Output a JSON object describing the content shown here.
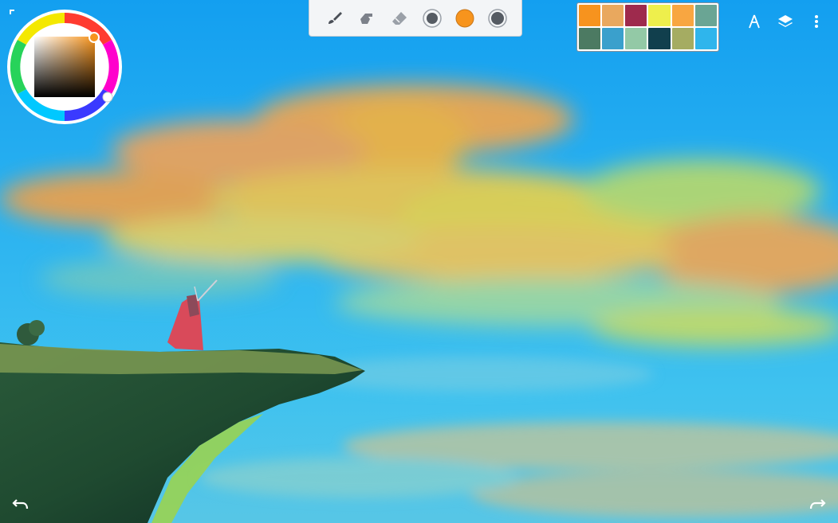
{
  "canvas": {
    "painting": "sky-cliff-painting"
  },
  "toolbar": {
    "tools": [
      {
        "name": "brush-tool",
        "icon": "brush-icon"
      },
      {
        "name": "smudge-tool",
        "icon": "smudge-icon"
      },
      {
        "name": "eraser-tool",
        "icon": "eraser-icon"
      },
      {
        "name": "brush-size-control",
        "icon": "size-dot-icon"
      },
      {
        "name": "current-color-indicator",
        "icon": "color-dot-icon",
        "color": "#f7941d"
      },
      {
        "name": "brush-opacity-control",
        "icon": "opacity-dot-icon"
      }
    ]
  },
  "palette": {
    "swatches": [
      "#f7931e",
      "#e9a85e",
      "#9e2a4d",
      "#eeef4c",
      "#f8a641",
      "#6aa594",
      "#4c7a62",
      "#3aa0cc",
      "#93c9a6",
      "#113f4d",
      "#a5ac62",
      "#2fb5ec"
    ]
  },
  "color_picker": {
    "current_color": "#f7941d",
    "hue_ring": "color-wheel-icon"
  },
  "top_actions": [
    "symmetry-icon",
    "layers-icon",
    "more-vert-icon"
  ],
  "bottom_actions": [
    "undo-icon",
    "redo-icon"
  ]
}
